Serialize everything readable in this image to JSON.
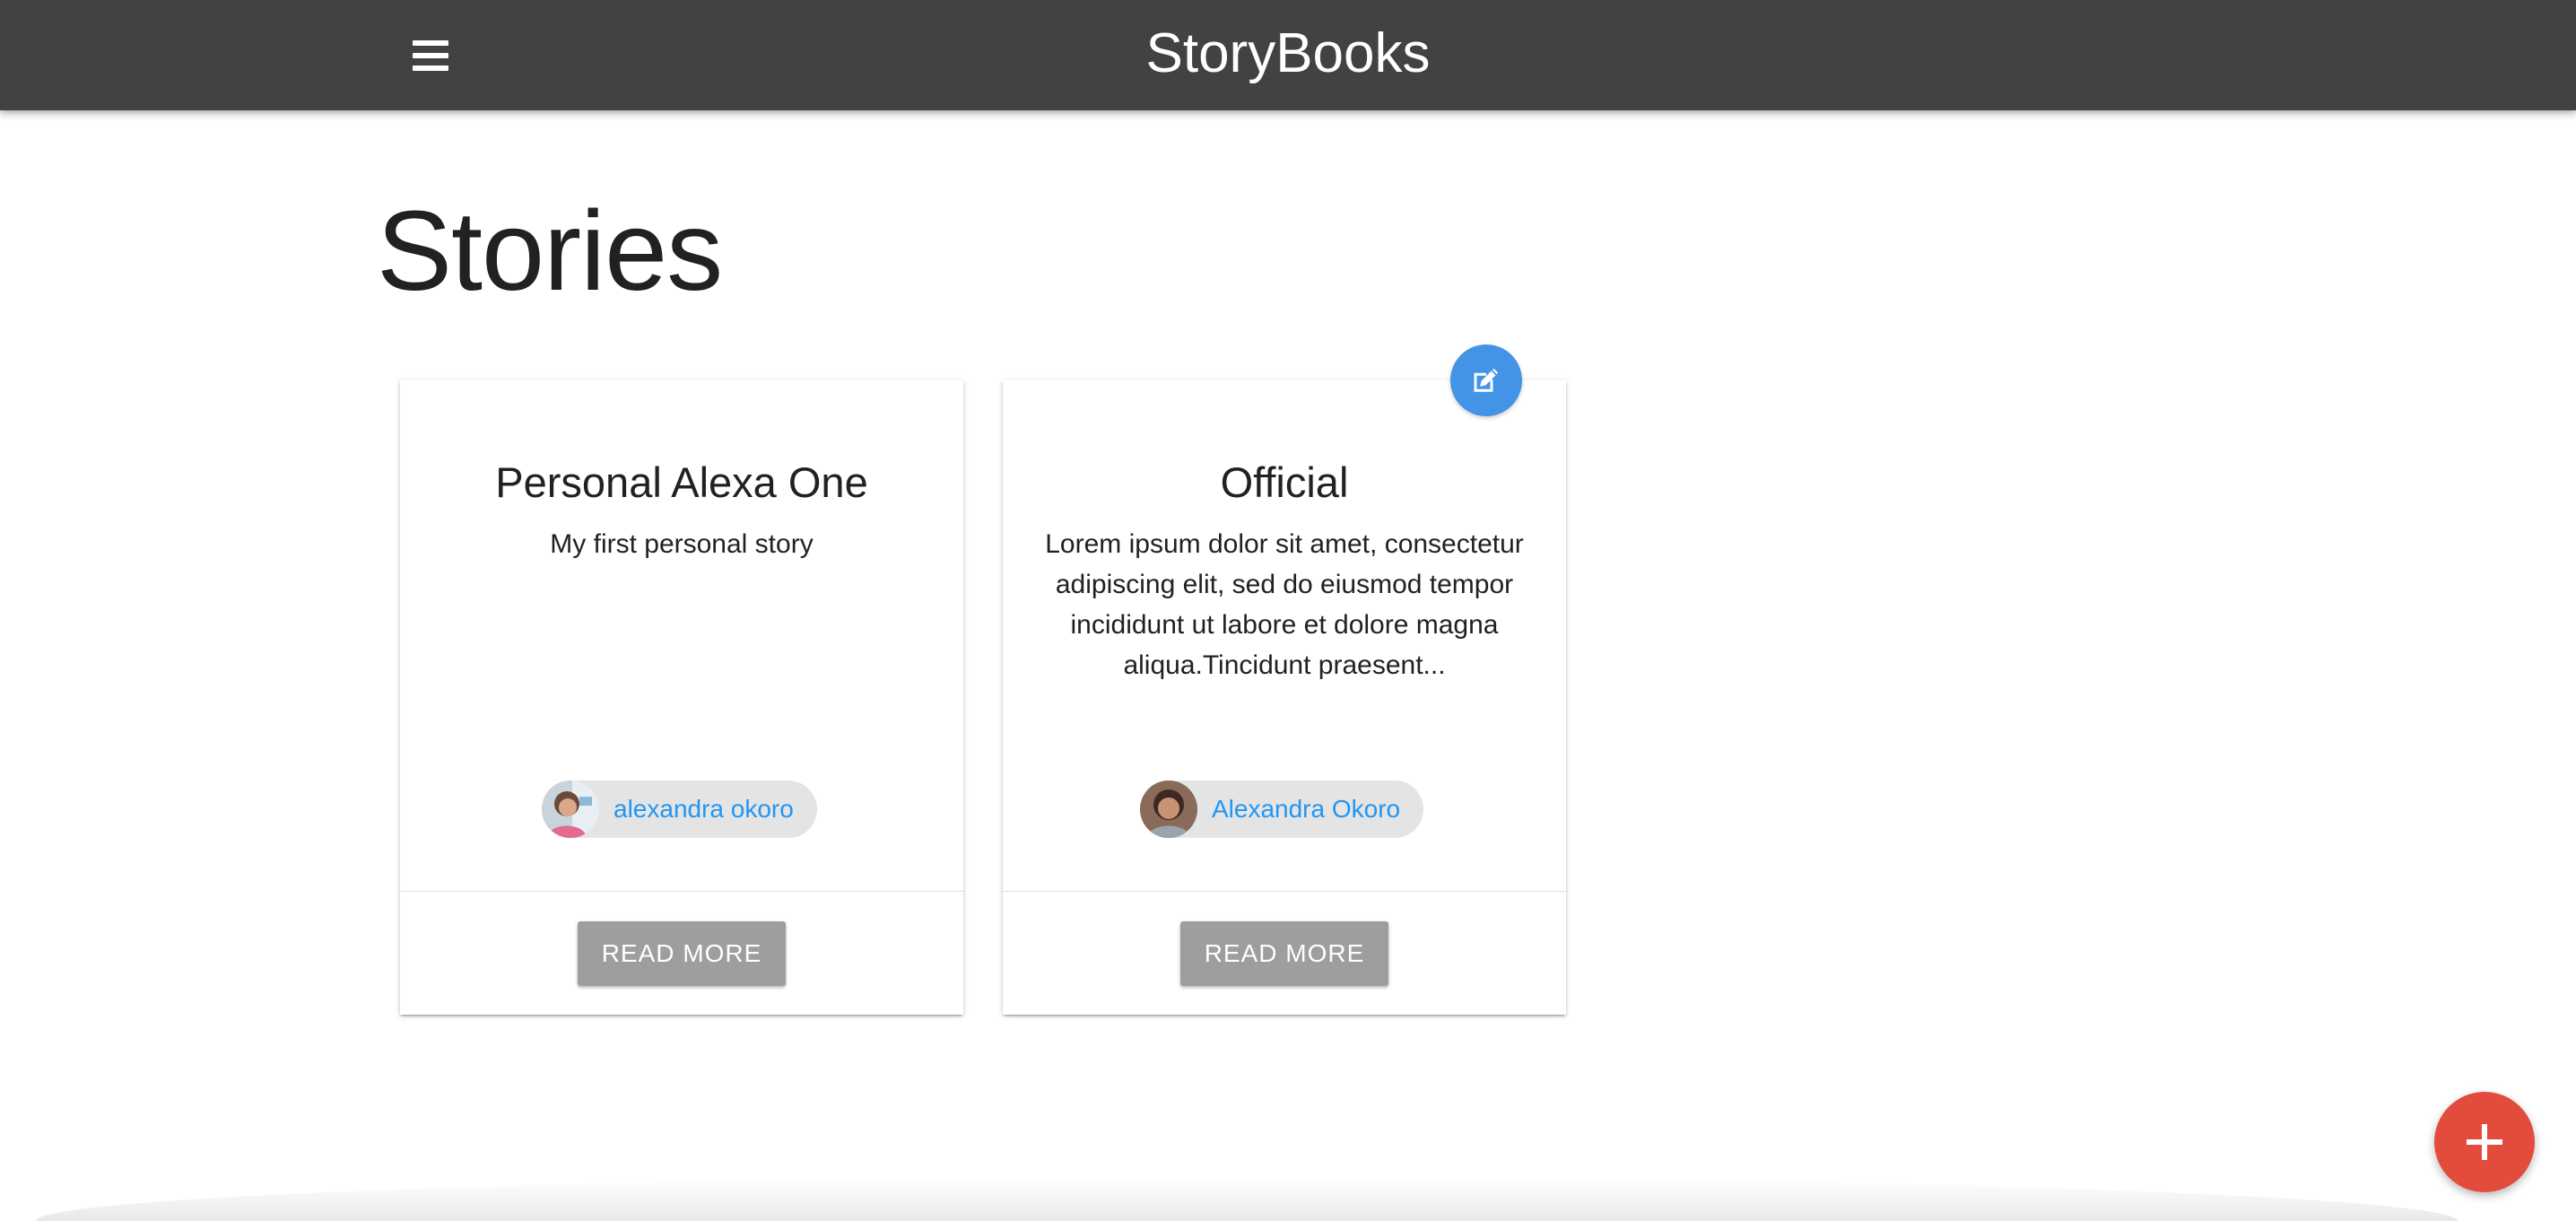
{
  "navbar": {
    "brand": "StoryBooks",
    "menu_icon": "hamburger-menu-icon",
    "background": "#424242"
  },
  "page": {
    "title": "Stories"
  },
  "stories": [
    {
      "title": "Personal Alexa One",
      "body": "My first personal story",
      "author": "alexandra okoro",
      "avatar_icon": "user-avatar",
      "action": "READ MORE",
      "editable": false
    },
    {
      "title": "Official",
      "body": "Lorem ipsum dolor sit amet, consectetur adipiscing elit, sed do eiusmod tempor incididunt ut labore et dolore magna aliqua.Tincidunt praesent...",
      "author": "Alexandra Okoro",
      "avatar_icon": "user-avatar",
      "action": "READ MORE",
      "editable": true
    }
  ],
  "fabs": {
    "edit_icon": "edit-icon",
    "add_icon": "plus-icon"
  },
  "colors": {
    "link": "#2196f3",
    "button_grey": "#9e9e9e",
    "edit_blue": "#4393e6",
    "add_red": "#e34b3d"
  }
}
